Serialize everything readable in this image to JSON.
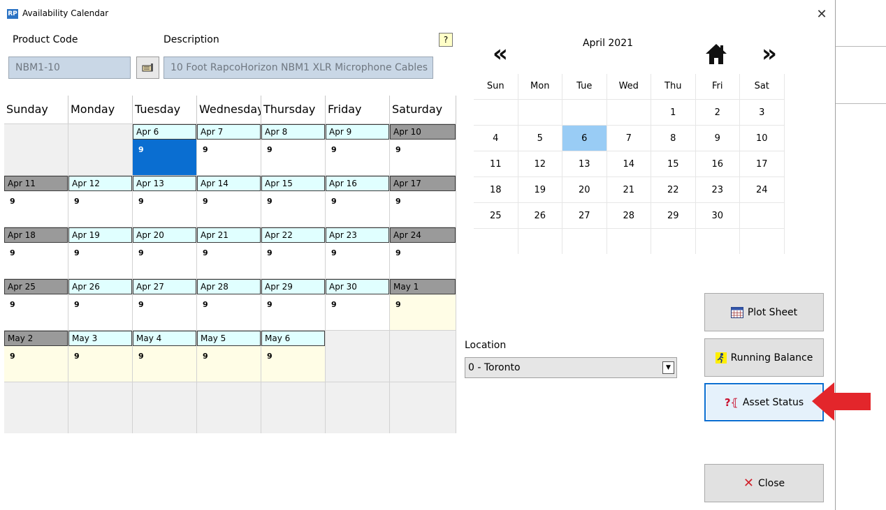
{
  "window": {
    "title": "Availability Calendar",
    "app_icon": "RP",
    "close_glyph": "✕"
  },
  "product": {
    "code_label": "Product Code",
    "description_label": "Description",
    "code_value": "NBM1-10",
    "description_value": "10 Foot RapcoHorizon NBM1 XLR Microphone Cables",
    "help_label": "?"
  },
  "calendar": {
    "day_headers": [
      "Sunday",
      "Monday",
      "Tuesday",
      "Wednesday",
      "Thursday",
      "Friday",
      "Saturday"
    ],
    "weeks": [
      [
        null,
        null,
        {
          "label": "Apr 6",
          "count": "9",
          "weekend": false,
          "selected": true
        },
        {
          "label": "Apr 7",
          "count": "9",
          "weekend": false
        },
        {
          "label": "Apr 8",
          "count": "9",
          "weekend": false
        },
        {
          "label": "Apr 9",
          "count": "9",
          "weekend": false
        },
        {
          "label": "Apr 10",
          "count": "9",
          "weekend": true
        }
      ],
      [
        {
          "label": "Apr 11",
          "count": "9",
          "weekend": true
        },
        {
          "label": "Apr 12",
          "count": "9",
          "weekend": false
        },
        {
          "label": "Apr 13",
          "count": "9",
          "weekend": false
        },
        {
          "label": "Apr 14",
          "count": "9",
          "weekend": false
        },
        {
          "label": "Apr 15",
          "count": "9",
          "weekend": false
        },
        {
          "label": "Apr 16",
          "count": "9",
          "weekend": false
        },
        {
          "label": "Apr 17",
          "count": "9",
          "weekend": true
        }
      ],
      [
        {
          "label": "Apr 18",
          "count": "9",
          "weekend": true
        },
        {
          "label": "Apr 19",
          "count": "9",
          "weekend": false
        },
        {
          "label": "Apr 20",
          "count": "9",
          "weekend": false
        },
        {
          "label": "Apr 21",
          "count": "9",
          "weekend": false
        },
        {
          "label": "Apr 22",
          "count": "9",
          "weekend": false
        },
        {
          "label": "Apr 23",
          "count": "9",
          "weekend": false
        },
        {
          "label": "Apr 24",
          "count": "9",
          "weekend": true
        }
      ],
      [
        {
          "label": "Apr 25",
          "count": "9",
          "weekend": true
        },
        {
          "label": "Apr 26",
          "count": "9",
          "weekend": false
        },
        {
          "label": "Apr 27",
          "count": "9",
          "weekend": false
        },
        {
          "label": "Apr 28",
          "count": "9",
          "weekend": false
        },
        {
          "label": "Apr 29",
          "count": "9",
          "weekend": false
        },
        {
          "label": "Apr 30",
          "count": "9",
          "weekend": false
        },
        {
          "label": "May 1",
          "count": "9",
          "weekend": true,
          "future": true
        }
      ],
      [
        {
          "label": "May 2",
          "count": "9",
          "weekend": true,
          "future": true
        },
        {
          "label": "May 3",
          "count": "9",
          "weekend": false,
          "future": true
        },
        {
          "label": "May 4",
          "count": "9",
          "weekend": false,
          "future": true
        },
        {
          "label": "May 5",
          "count": "9",
          "weekend": false,
          "future": true
        },
        {
          "label": "May 6",
          "count": "9",
          "weekend": false,
          "future": true
        },
        null,
        null
      ],
      [
        null,
        null,
        null,
        null,
        null,
        null,
        null
      ]
    ]
  },
  "mini_calendar": {
    "month_title": "April 2021",
    "prev_glyph": "«",
    "next_glyph": "»",
    "home_icon": "home-icon",
    "headers": [
      "Sun",
      "Mon",
      "Tue",
      "Wed",
      "Thu",
      "Fri",
      "Sat"
    ],
    "rows": [
      [
        "",
        "",
        "",
        "",
        "1",
        "2",
        "3"
      ],
      [
        "4",
        "5",
        "6",
        "7",
        "8",
        "9",
        "10"
      ],
      [
        "11",
        "12",
        "13",
        "14",
        "15",
        "16",
        "17"
      ],
      [
        "18",
        "19",
        "20",
        "21",
        "22",
        "23",
        "24"
      ],
      [
        "25",
        "26",
        "27",
        "28",
        "29",
        "30",
        ""
      ],
      [
        "",
        "",
        "",
        "",
        "",
        "",
        ""
      ]
    ],
    "today": "6"
  },
  "location": {
    "label": "Location",
    "value": "0 - Toronto"
  },
  "buttons": {
    "plot_sheet": "Plot Sheet",
    "running_balance": "Running Balance",
    "asset_status": "Asset Status",
    "close": "Close"
  },
  "colors": {
    "accent": "#0a6ed1",
    "today": "#99ccf5",
    "weekday_label": "#e0ffff",
    "weekend_label": "#9a9a9a",
    "arrow": "#e3262b"
  }
}
